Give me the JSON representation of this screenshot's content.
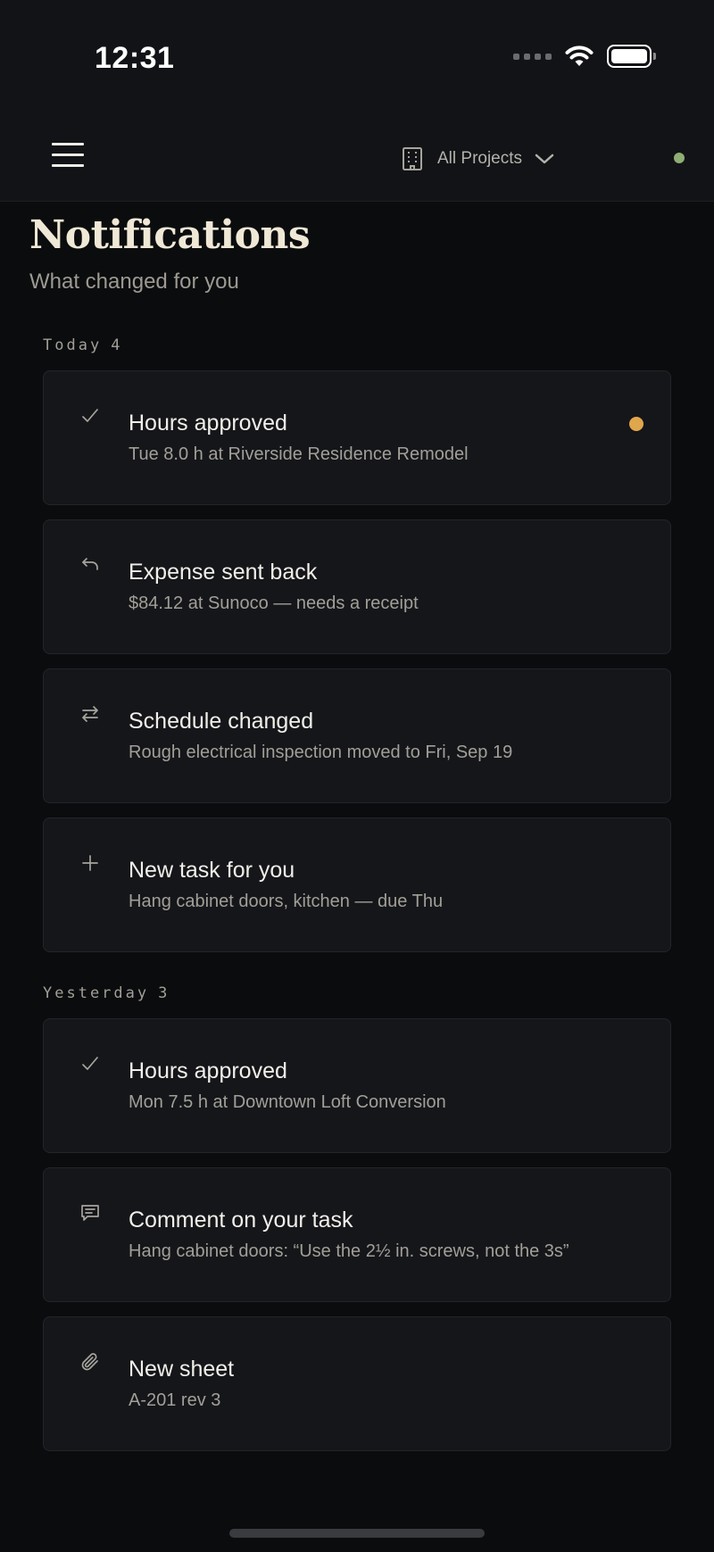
{
  "status_bar": {
    "time": "12:31"
  },
  "header": {
    "project_label": "All Projects"
  },
  "page": {
    "title": "Notifications",
    "subtitle": "What changed for you"
  },
  "colors": {
    "unread": "#e0a64c",
    "online": "#8fae73",
    "title": "#efe8d6"
  },
  "sections": [
    {
      "label": "Today",
      "count": "4",
      "items": [
        {
          "icon": "check-icon",
          "title": "Hours approved",
          "desc": "Tue 8.0 h at Riverside Residence Remodel",
          "unread": true
        },
        {
          "icon": "undo-icon",
          "title": "Expense sent back",
          "desc": "$84.12 at Sunoco — needs a receipt",
          "unread": false
        },
        {
          "icon": "swap-arrows-icon",
          "title": "Schedule changed",
          "desc": "Rough electrical inspection moved to Fri, Sep 19",
          "unread": false
        },
        {
          "icon": "plus-icon",
          "title": "New task for you",
          "desc": "Hang cabinet doors, kitchen — due Thu",
          "unread": false
        }
      ]
    },
    {
      "label": "Yesterday",
      "count": "3",
      "items": [
        {
          "icon": "check-icon",
          "title": "Hours approved",
          "desc": "Mon 7.5 h at Downtown Loft Conversion",
          "unread": false
        },
        {
          "icon": "comment-icon",
          "title": "Comment on your task",
          "desc": "Hang cabinet doors: “Use the 2½ in. screws, not the 3s”",
          "unread": false
        },
        {
          "icon": "paperclip-icon",
          "title": "New sheet",
          "desc": "A-201 rev 3",
          "unread": false
        }
      ]
    }
  ]
}
